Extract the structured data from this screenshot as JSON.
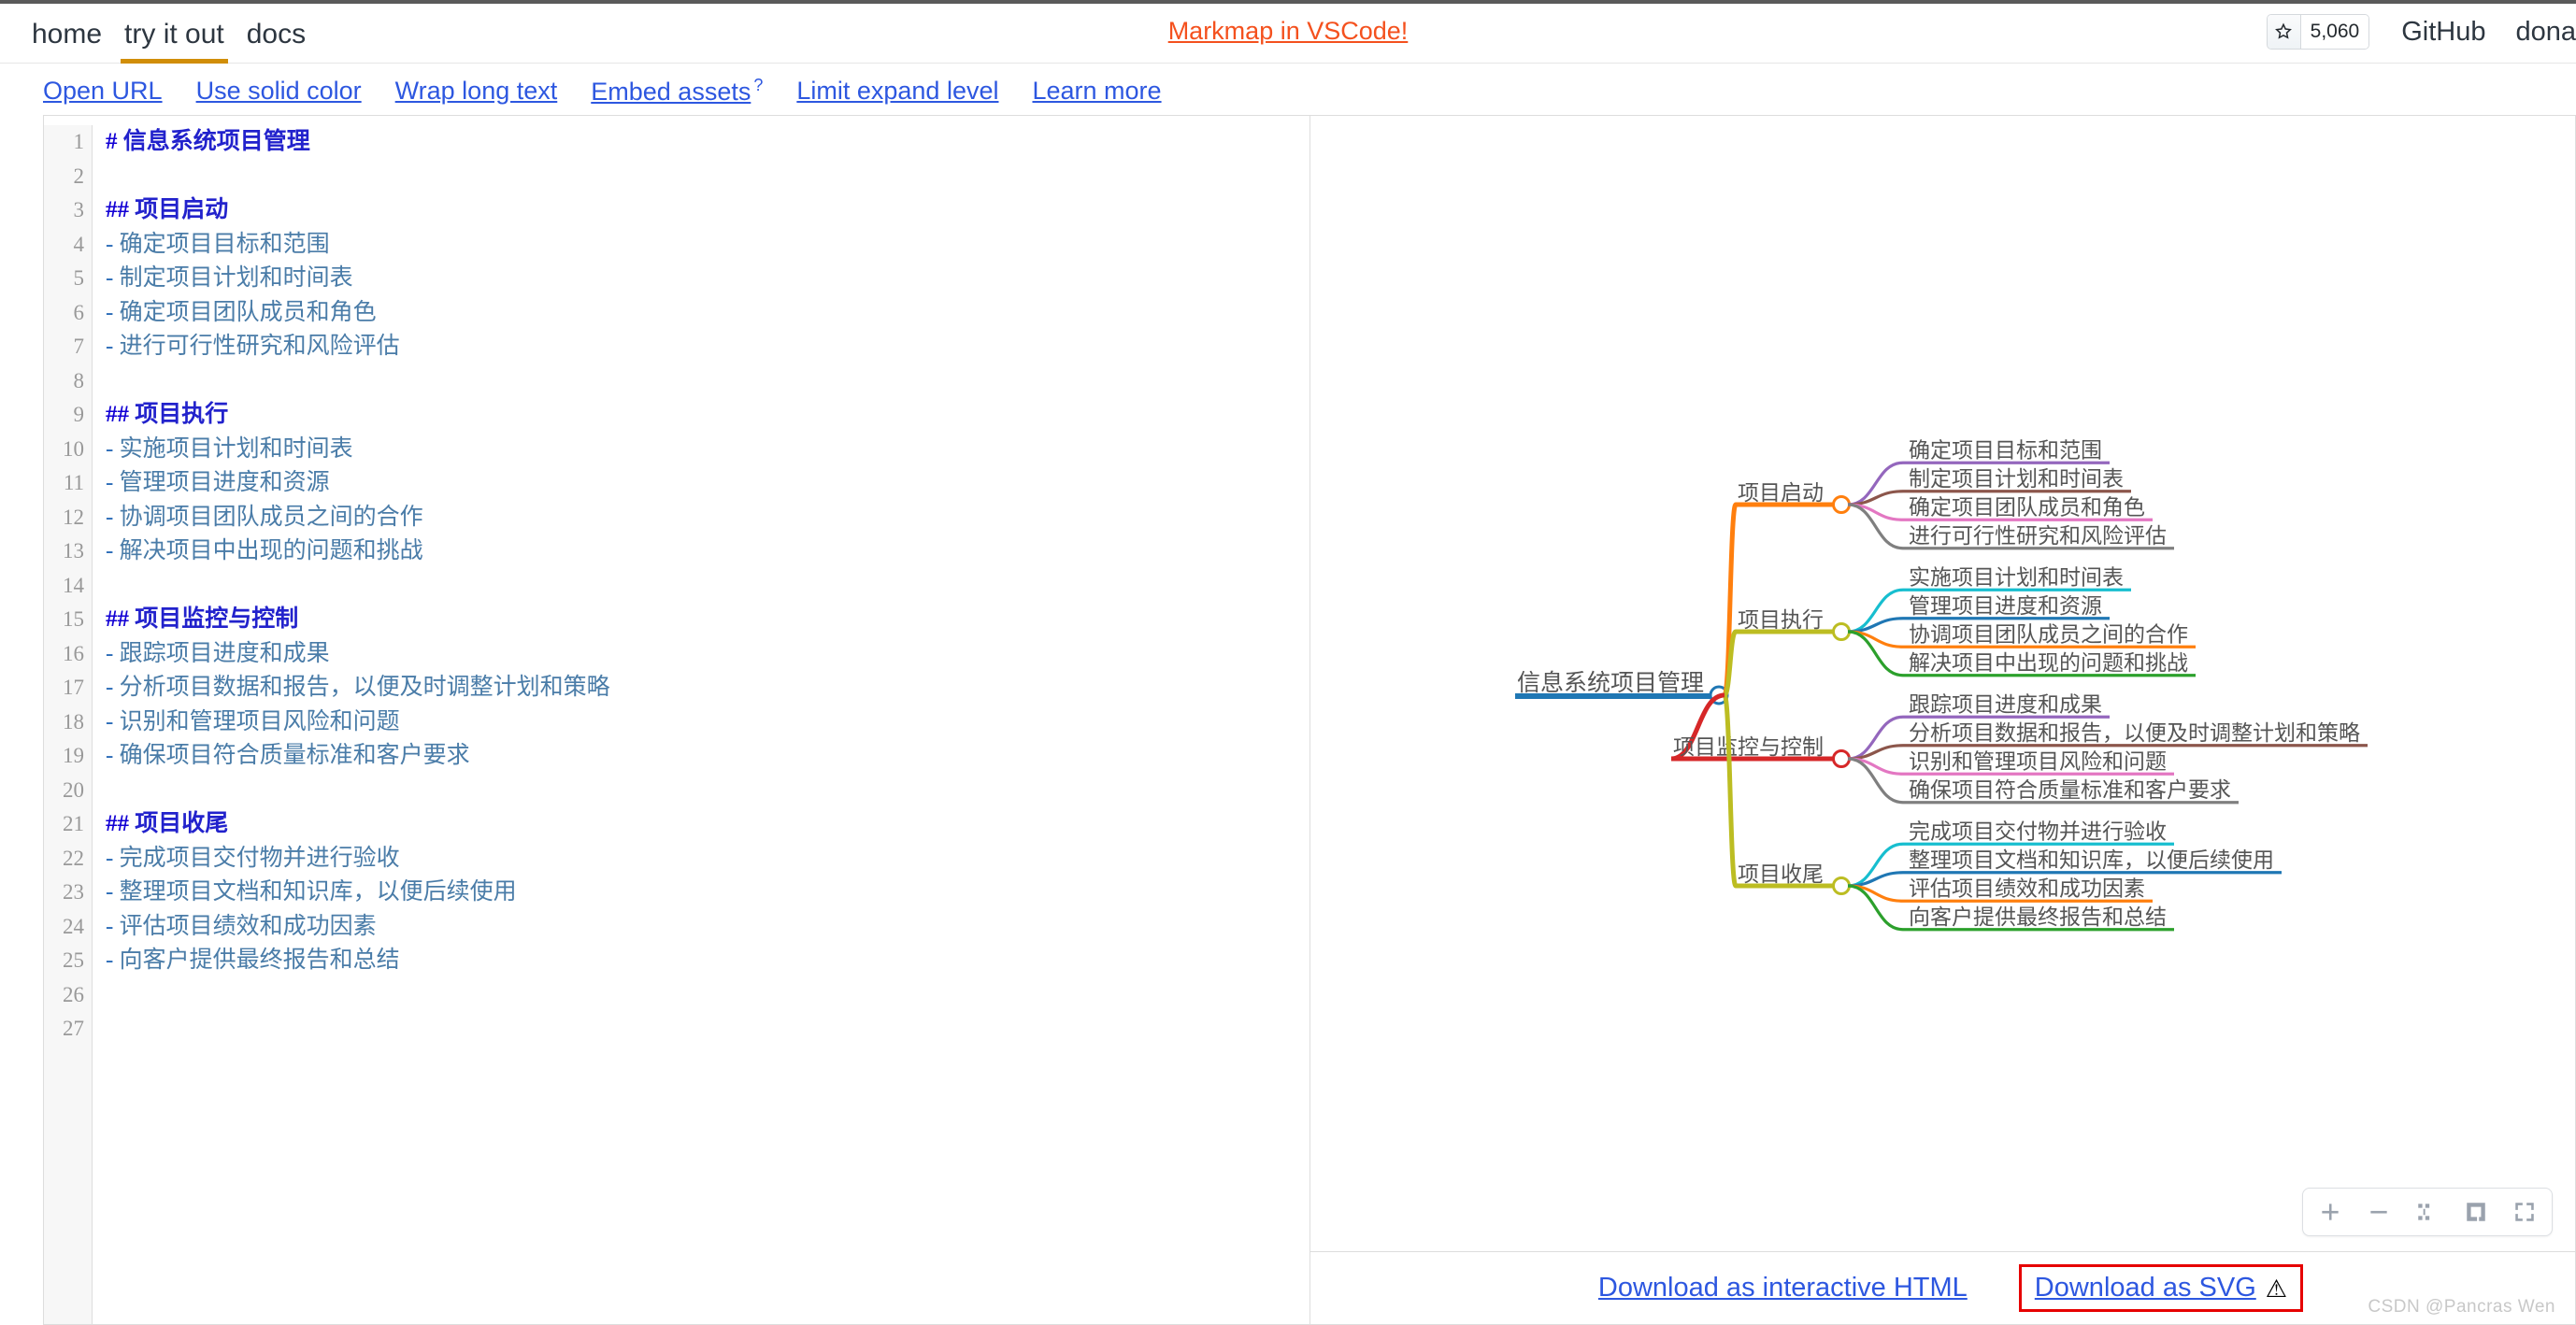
{
  "nav": {
    "links": [
      {
        "label": "home",
        "active": false
      },
      {
        "label": "try it out",
        "active": true
      },
      {
        "label": "docs",
        "active": false
      }
    ],
    "promo": "Markmap in VSCode!",
    "star_count": "5,060",
    "github": "GitHub",
    "donate": "dona",
    "accent_orange": "#f4511e",
    "active_underline": "#d18e08"
  },
  "options": [
    {
      "label": "Open URL",
      "sup": ""
    },
    {
      "label": "Use solid color",
      "sup": ""
    },
    {
      "label": "Wrap long text",
      "sup": ""
    },
    {
      "label": "Embed assets",
      "sup": "?"
    },
    {
      "label": "Limit expand level",
      "sup": ""
    },
    {
      "label": "Learn more",
      "sup": ""
    }
  ],
  "editor": {
    "line_count": 27,
    "lines": [
      {
        "n": 1,
        "type": "h1",
        "marker": "#",
        "text": "信息系统项目管理"
      },
      {
        "n": 2,
        "type": "blank",
        "marker": "",
        "text": ""
      },
      {
        "n": 3,
        "type": "h2",
        "marker": "##",
        "text": "项目启动"
      },
      {
        "n": 4,
        "type": "bullet",
        "marker": "-",
        "text": "确定项目目标和范围"
      },
      {
        "n": 5,
        "type": "bullet",
        "marker": "-",
        "text": "制定项目计划和时间表"
      },
      {
        "n": 6,
        "type": "bullet",
        "marker": "-",
        "text": "确定项目团队成员和角色"
      },
      {
        "n": 7,
        "type": "bullet",
        "marker": "-",
        "text": "进行可行性研究和风险评估"
      },
      {
        "n": 8,
        "type": "blank",
        "marker": "",
        "text": ""
      },
      {
        "n": 9,
        "type": "h2",
        "marker": "##",
        "text": "项目执行"
      },
      {
        "n": 10,
        "type": "bullet",
        "marker": "-",
        "text": "实施项目计划和时间表"
      },
      {
        "n": 11,
        "type": "bullet",
        "marker": "-",
        "text": "管理项目进度和资源"
      },
      {
        "n": 12,
        "type": "bullet",
        "marker": "-",
        "text": "协调项目团队成员之间的合作"
      },
      {
        "n": 13,
        "type": "bullet",
        "marker": "-",
        "text": "解决项目中出现的问题和挑战"
      },
      {
        "n": 14,
        "type": "blank",
        "marker": "",
        "text": ""
      },
      {
        "n": 15,
        "type": "h2",
        "marker": "##",
        "text": "项目监控与控制"
      },
      {
        "n": 16,
        "type": "bullet",
        "marker": "-",
        "text": "跟踪项目进度和成果"
      },
      {
        "n": 17,
        "type": "bullet",
        "marker": "-",
        "text": "分析项目数据和报告，以便及时调整计划和策略"
      },
      {
        "n": 18,
        "type": "bullet",
        "marker": "-",
        "text": "识别和管理项目风险和问题"
      },
      {
        "n": 19,
        "type": "bullet",
        "marker": "-",
        "text": "确保项目符合质量标准和客户要求"
      },
      {
        "n": 20,
        "type": "blank",
        "marker": "",
        "text": ""
      },
      {
        "n": 21,
        "type": "h2",
        "marker": "##",
        "text": "项目收尾"
      },
      {
        "n": 22,
        "type": "bullet",
        "marker": "-",
        "text": "完成项目交付物并进行验收"
      },
      {
        "n": 23,
        "type": "bullet",
        "marker": "-",
        "text": "整理项目文档和知识库，以便后续使用"
      },
      {
        "n": 24,
        "type": "bullet",
        "marker": "-",
        "text": "评估项目绩效和成功因素"
      },
      {
        "n": 25,
        "type": "bullet",
        "marker": "-",
        "text": "向客户提供最终报告和总结"
      },
      {
        "n": 26,
        "type": "blank",
        "marker": "",
        "text": ""
      },
      {
        "n": 27,
        "type": "blank",
        "marker": "",
        "text": ""
      }
    ]
  },
  "mindmap": {
    "root": {
      "label": "信息系统项目管理",
      "color": "#1f77b4"
    },
    "branches": [
      {
        "label": "项目启动",
        "color": "#ff7f0e",
        "children": [
          {
            "label": "确定项目目标和范围",
            "color": "#9467bd"
          },
          {
            "label": "制定项目计划和时间表",
            "color": "#8c564b"
          },
          {
            "label": "确定项目团队成员和角色",
            "color": "#e377c2"
          },
          {
            "label": "进行可行性研究和风险评估",
            "color": "#7f7f7f"
          }
        ]
      },
      {
        "label": "项目执行",
        "color": "#bcbd22",
        "children": [
          {
            "label": "实施项目计划和时间表",
            "color": "#17becf"
          },
          {
            "label": "管理项目进度和资源",
            "color": "#1f77b4"
          },
          {
            "label": "协调项目团队成员之间的合作",
            "color": "#ff7f0e"
          },
          {
            "label": "解决项目中出现的问题和挑战",
            "color": "#2ca02c"
          }
        ]
      },
      {
        "label": "项目监控与控制",
        "color": "#d62728",
        "children": [
          {
            "label": "跟踪项目进度和成果",
            "color": "#9467bd"
          },
          {
            "label": "分析项目数据和报告，以便及时调整计划和策略",
            "color": "#8c564b"
          },
          {
            "label": "识别和管理项目风险和问题",
            "color": "#e377c2"
          },
          {
            "label": "确保项目符合质量标准和客户要求",
            "color": "#7f7f7f"
          }
        ]
      },
      {
        "label": "项目收尾",
        "color": "#bcbd22",
        "children": [
          {
            "label": "完成项目交付物并进行验收",
            "color": "#17becf"
          },
          {
            "label": "整理项目文档和知识库，以便后续使用",
            "color": "#1f77b4"
          },
          {
            "label": "评估项目绩效和成功因素",
            "color": "#ff7f0e"
          },
          {
            "label": "向客户提供最终报告和总结",
            "color": "#2ca02c"
          }
        ]
      }
    ]
  },
  "zoom_toolbar": {
    "buttons": [
      "zoom-in",
      "zoom-out",
      "fit-center",
      "recursive-toggle",
      "fullscreen"
    ]
  },
  "download": {
    "html_label": "Download as interactive HTML",
    "svg_label": "Download as SVG",
    "svg_warning": "⚠",
    "highlight_color": "#e60000"
  },
  "watermark": "CSDN @Pancras Wen"
}
